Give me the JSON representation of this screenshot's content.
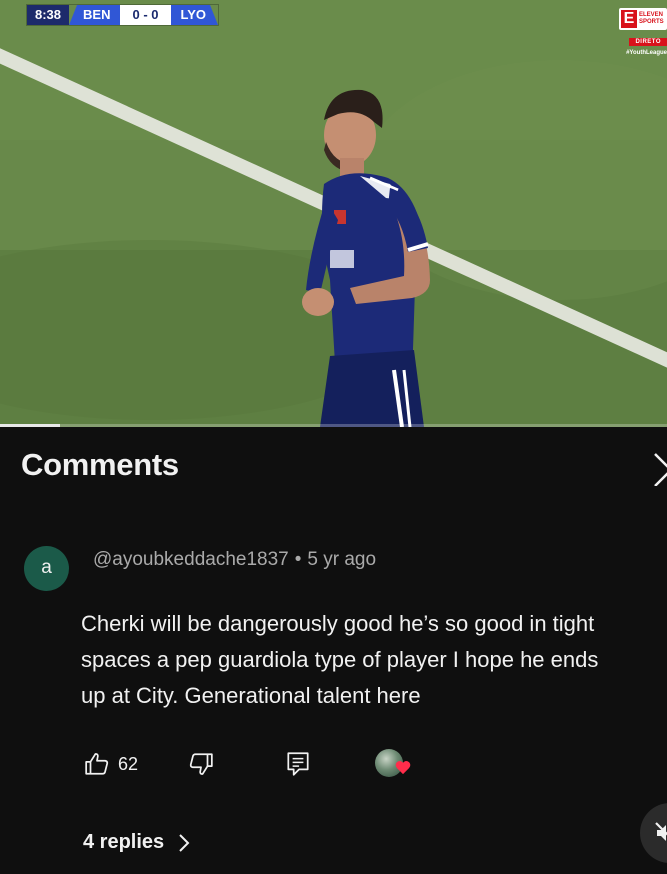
{
  "video": {
    "scoreboard": {
      "clock": "8:38",
      "home_team": "BEN",
      "score": "0 - 0",
      "away_team": "LYO"
    },
    "broadcaster": {
      "logo_letter": "E",
      "logo_text": "ELEVEN SPORTS",
      "live_tag": "DIRETO",
      "hashtag": "#YouthLeague"
    },
    "progress_fraction": 0.09
  },
  "comments": {
    "title": "Comments",
    "items": [
      {
        "avatar_letter": "a",
        "author": "@ayoubkeddache1837",
        "separator": "•",
        "time": "5 yr ago",
        "text_lines": [
          "Cherki will be dangerously good he’s so good in tight",
          "spaces a pep guardiola type of player I hope he ends",
          "up at City. Generational talent here"
        ],
        "likes": "62",
        "replies_label": "4 replies"
      }
    ]
  },
  "icons": {
    "like": "thumb-up-icon",
    "dislike": "thumb-down-icon",
    "reply": "comment-icon",
    "creator_heart": "creator-heart-icon",
    "close": "close-icon",
    "replies_chevron": "chevron-right-icon",
    "mute": "mute-icon"
  },
  "colors": {
    "background": "#0f0f0f",
    "avatar": "#1b5a49",
    "heart": "#ff2d4b",
    "secondary_text": "#aaaaaa"
  }
}
